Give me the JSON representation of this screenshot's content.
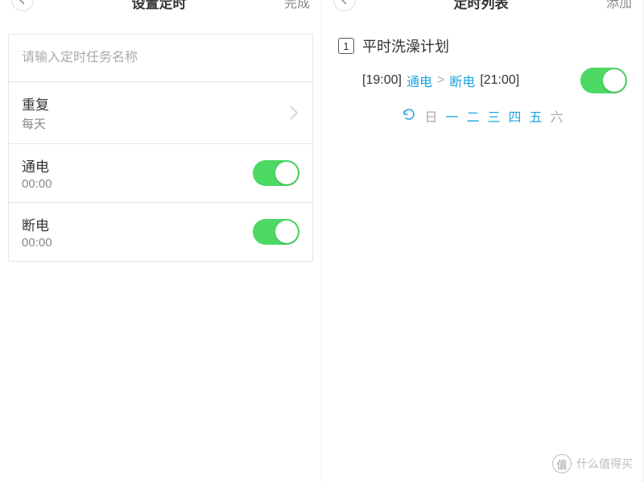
{
  "left": {
    "header": {
      "title": "设置定时",
      "action": "完成"
    },
    "placeholder": "请输入定时任务名称",
    "repeat": {
      "label": "重复",
      "value": "每天"
    },
    "powerOn": {
      "label": "通电",
      "time": "00:00",
      "enabled": true
    },
    "powerOff": {
      "label": "断电",
      "time": "00:00",
      "enabled": true
    }
  },
  "right": {
    "header": {
      "title": "定时列表",
      "action": "添加"
    },
    "task": {
      "index": "1",
      "name": "平时洗澡计划",
      "onTime": "[19:00]",
      "onLabel": "通电",
      "sep": ">",
      "offLabel": "断电",
      "offTime": "[21:00]",
      "enabled": true,
      "days": [
        "日",
        "一",
        "二",
        "三",
        "四",
        "五",
        "六"
      ],
      "activeDays": [
        false,
        true,
        true,
        true,
        true,
        true,
        false
      ]
    }
  },
  "watermark": {
    "logo": "值",
    "text": "什么值得买"
  }
}
